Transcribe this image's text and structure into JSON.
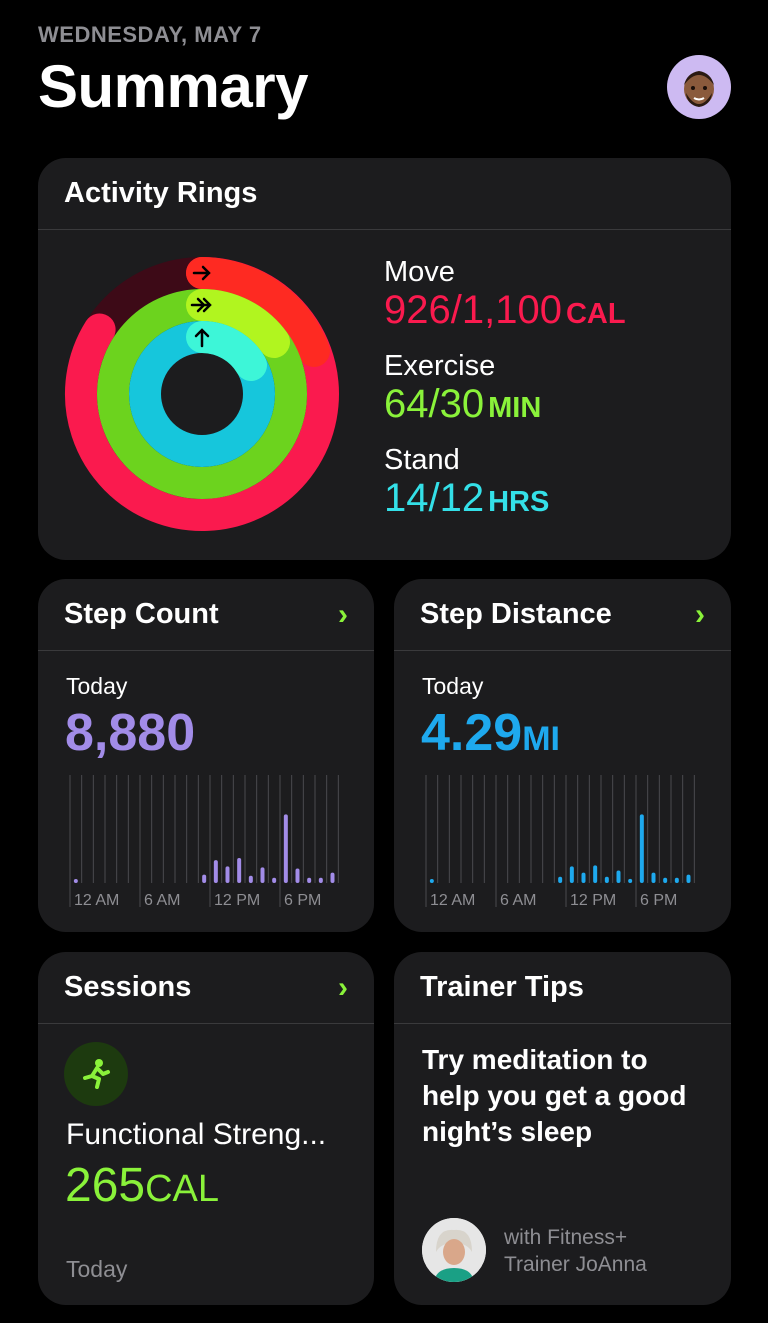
{
  "header": {
    "date": "WEDNESDAY, MAY 7",
    "title": "Summary"
  },
  "activity_rings": {
    "title": "Activity Rings",
    "move": {
      "label": "Move",
      "value": "926/1,100",
      "unit": "CAL",
      "progress": 0.842
    },
    "exercise": {
      "label": "Exercise",
      "value": "64/30",
      "unit": "MIN",
      "progress": 2.13
    },
    "stand": {
      "label": "Stand",
      "value": "14/12",
      "unit": "HRS",
      "progress": 1.17
    }
  },
  "step_count": {
    "title": "Step Count",
    "period": "Today",
    "value": "8,880",
    "color": "#a28ce8",
    "x_tick_labels": [
      "12 AM",
      "6 AM",
      "12 PM",
      "6 PM"
    ],
    "hourly_relative": [
      0.03,
      0,
      0,
      0,
      0,
      0,
      0,
      0,
      0,
      0,
      0,
      0.08,
      0.22,
      0.16,
      0.24,
      0.07,
      0.15,
      0.05,
      0.66,
      0.14,
      0.05,
      0.05,
      0.1,
      0
    ]
  },
  "step_distance": {
    "title": "Step Distance",
    "period": "Today",
    "value": "4.29",
    "unit": "MI",
    "color": "#1ea9ee",
    "x_tick_labels": [
      "12 AM",
      "6 AM",
      "12 PM",
      "6 PM"
    ],
    "hourly_relative": [
      0.03,
      0,
      0,
      0,
      0,
      0,
      0,
      0,
      0,
      0,
      0,
      0.06,
      0.16,
      0.1,
      0.17,
      0.06,
      0.12,
      0.04,
      0.66,
      0.1,
      0.05,
      0.05,
      0.08,
      0
    ]
  },
  "sessions": {
    "title": "Sessions",
    "workout": "Functional Streng...",
    "calories": "265",
    "unit": "CAL",
    "date": "Today"
  },
  "trainer_tips": {
    "title": "Trainer Tips",
    "tip": "Try meditation to help you get a good night’s sleep",
    "trainer_line1": "with Fitness+",
    "trainer_line2": "Trainer JoAnna"
  },
  "colors": {
    "move": "#fa1a4e",
    "exercise": "#8af23a",
    "stand": "#34e0e8",
    "accent_green": "#8af23a"
  }
}
